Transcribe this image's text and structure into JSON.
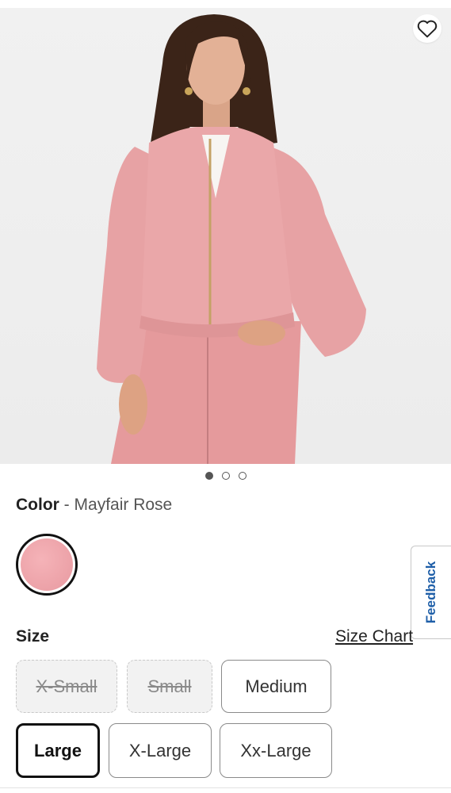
{
  "product": {
    "image_alt": "Model wearing pink tweed zip-front bomber jacket with matching wide-leg pants"
  },
  "icons": {
    "favorite": "heart-outline-icon"
  },
  "carousel": {
    "total": 3,
    "active": 1
  },
  "color": {
    "label": "Color",
    "separator": "-",
    "value": "Mayfair Rose",
    "swatch_hex": "#eea5ab"
  },
  "feedback": {
    "label": "Feedback",
    "color": "#1f5fa8"
  },
  "size": {
    "label": "Size",
    "chart_link": "Size Chart",
    "options": [
      {
        "label": "X-Small",
        "available": false,
        "selected": false
      },
      {
        "label": "Small",
        "available": false,
        "selected": false
      },
      {
        "label": "Medium",
        "available": true,
        "selected": false
      },
      {
        "label": "Large",
        "available": true,
        "selected": true
      },
      {
        "label": "X-Large",
        "available": true,
        "selected": false
      },
      {
        "label": "Xx-Large",
        "available": true,
        "selected": false
      }
    ]
  }
}
